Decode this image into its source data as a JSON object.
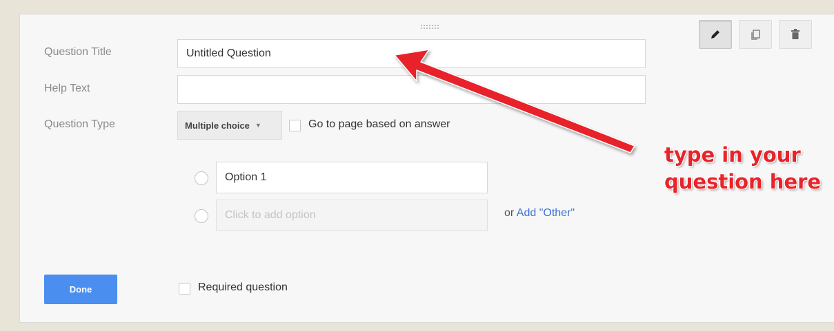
{
  "form": {
    "question_title_label": "Question Title",
    "question_title_value": "Untitled Question",
    "help_text_label": "Help Text",
    "help_text_value": "",
    "question_type_label": "Question Type",
    "question_type_value": "Multiple choice",
    "go_to_page_label": "Go to page based on answer",
    "options": [
      {
        "value": "Option 1"
      }
    ],
    "add_option_placeholder": "Click to add option",
    "or_text": "or",
    "add_other_link": "Add \"Other\"",
    "done_label": "Done",
    "required_label": "Required question"
  },
  "toolbar": {
    "icons": [
      "pencil-icon",
      "copy-icon",
      "trash-icon"
    ]
  },
  "annotation": {
    "line1": "type in your",
    "line2": "question here",
    "color": "#e8242a"
  },
  "colors": {
    "done_button": "#4a8ef0",
    "link": "#3d6fd6"
  }
}
